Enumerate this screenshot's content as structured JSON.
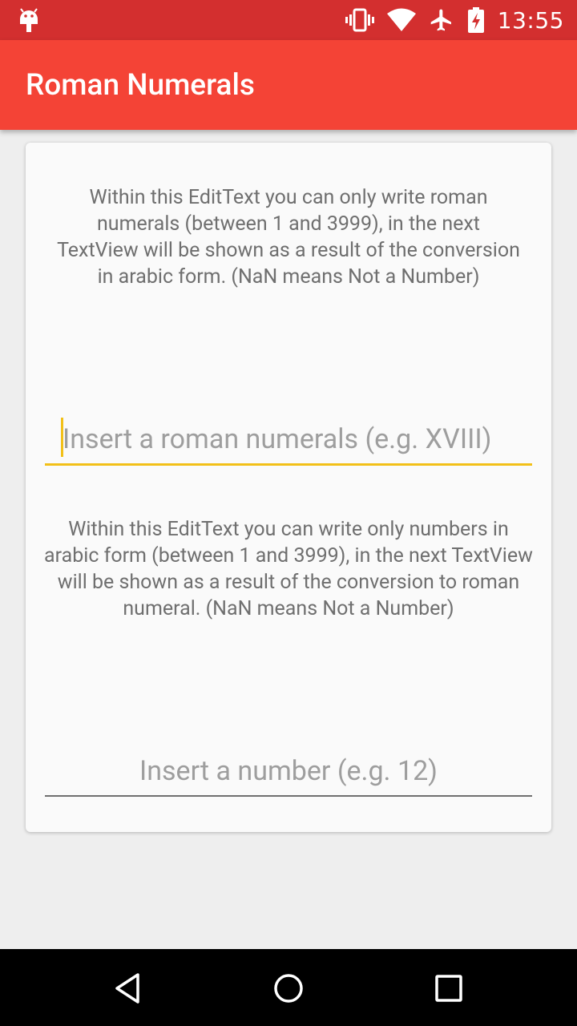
{
  "status_bar": {
    "time": "13:55",
    "icons": [
      "android-debug-icon",
      "vibrate-icon",
      "wifi-icon",
      "airplane-mode-icon",
      "battery-charging-icon"
    ]
  },
  "app_bar": {
    "title": "Roman Numerals"
  },
  "card": {
    "roman_description": "Within this EditText you can only write roman numerals (between 1 and 3999), in the next TextView will be shown as a result of the conversion in arabic form. (NaN means Not a Number)",
    "roman_input": {
      "placeholder": "Insert a roman numerals (e.g. XVIII)",
      "value": ""
    },
    "arabic_description": "Within this EditText you can write only numbers in arabic form (between 1 and 3999), in the next TextView will be shown as a result of the conversion to roman numeral. (NaN means Not a Number)",
    "arabic_input": {
      "placeholder": "Insert a number (e.g. 12)",
      "value": ""
    }
  },
  "nav_bar": {
    "buttons": [
      "back-icon",
      "home-icon",
      "recents-icon"
    ]
  },
  "colors": {
    "status_bar": "#d32f2f",
    "app_bar": "#f44336",
    "accent": "#f2c018",
    "background": "#eeeeee",
    "card": "#fafafa"
  }
}
